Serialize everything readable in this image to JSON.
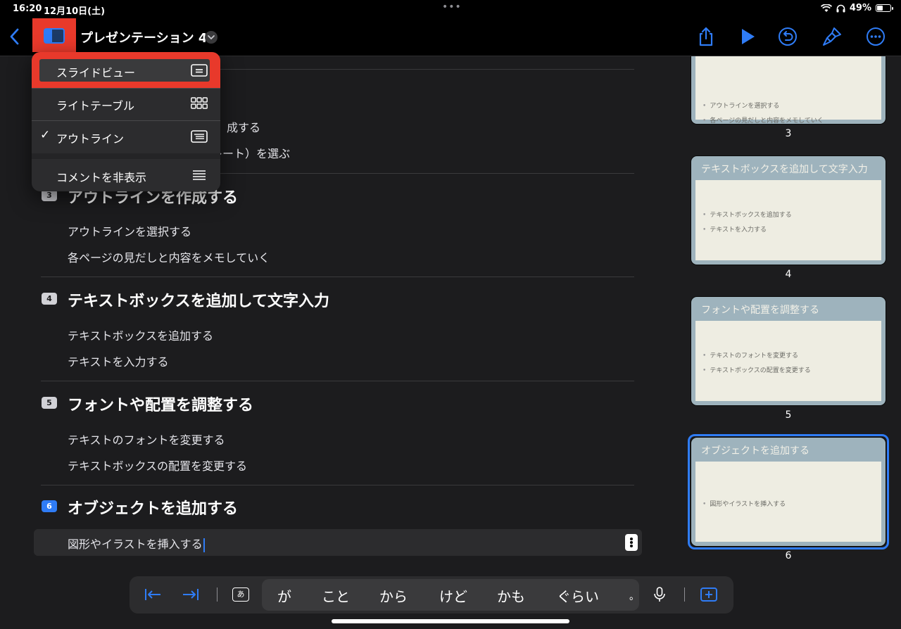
{
  "status_bar": {
    "time": "16:20",
    "date": "12月10日(土)",
    "battery": "49%",
    "battery_level": 0.49
  },
  "toolbar": {
    "title": "プレゼンテーション 4"
  },
  "menu": {
    "items": [
      {
        "label": "スライドビュー",
        "checked": false
      },
      {
        "label": "ライトテーブル",
        "checked": false
      },
      {
        "label": "アウトライン",
        "checked": true
      },
      {
        "label": "コメントを非表示",
        "checked": false
      }
    ],
    "check_mark": "✓"
  },
  "outline": {
    "partial_bullets": [
      "成する",
      "レート）を選ぶ"
    ],
    "sections": [
      {
        "number": "3",
        "title": "アウトラインを作成する",
        "bullets": [
          "アウトラインを選択する",
          "各ページの見だしと内容をメモしていく"
        ]
      },
      {
        "number": "4",
        "title": "テキストボックスを追加して文字入力",
        "bullets": [
          "テキストボックスを追加する",
          "テキストを入力する"
        ]
      },
      {
        "number": "5",
        "title": "フォントや配置を調整する",
        "bullets": [
          "テキストのフォントを変更する",
          "テキストボックスの配置を変更する"
        ]
      },
      {
        "number": "6",
        "title": "オブジェクトを追加する",
        "bullets": [
          "図形やイラストを挿入する"
        ]
      }
    ]
  },
  "thumbnails": [
    {
      "number": "3",
      "title": "",
      "bullets": [
        "アウトラインを選択する",
        "各ページの見だしと内容をメモしていく"
      ]
    },
    {
      "number": "4",
      "title": "テキストボックスを追加して文字入力",
      "bullets": [
        "テキストボックスを追加する",
        "テキストを入力する"
      ]
    },
    {
      "number": "5",
      "title": "フォントや配置を調整する",
      "bullets": [
        "テキストのフォントを変更する",
        "テキストボックスの配置を変更する"
      ]
    },
    {
      "number": "6",
      "title": "オブジェクトを追加する",
      "bullets": [
        "図形やイラストを挿入する"
      ],
      "selected": true
    }
  ],
  "keyboard_bar": {
    "ime_label": "あ",
    "predictions": [
      "が",
      "こと",
      "から",
      "けど",
      "かも",
      "ぐらい",
      "。"
    ]
  },
  "colors": {
    "accent": "#2f7cf6",
    "highlight": "#e8392b",
    "background": "#1c1c1e"
  }
}
